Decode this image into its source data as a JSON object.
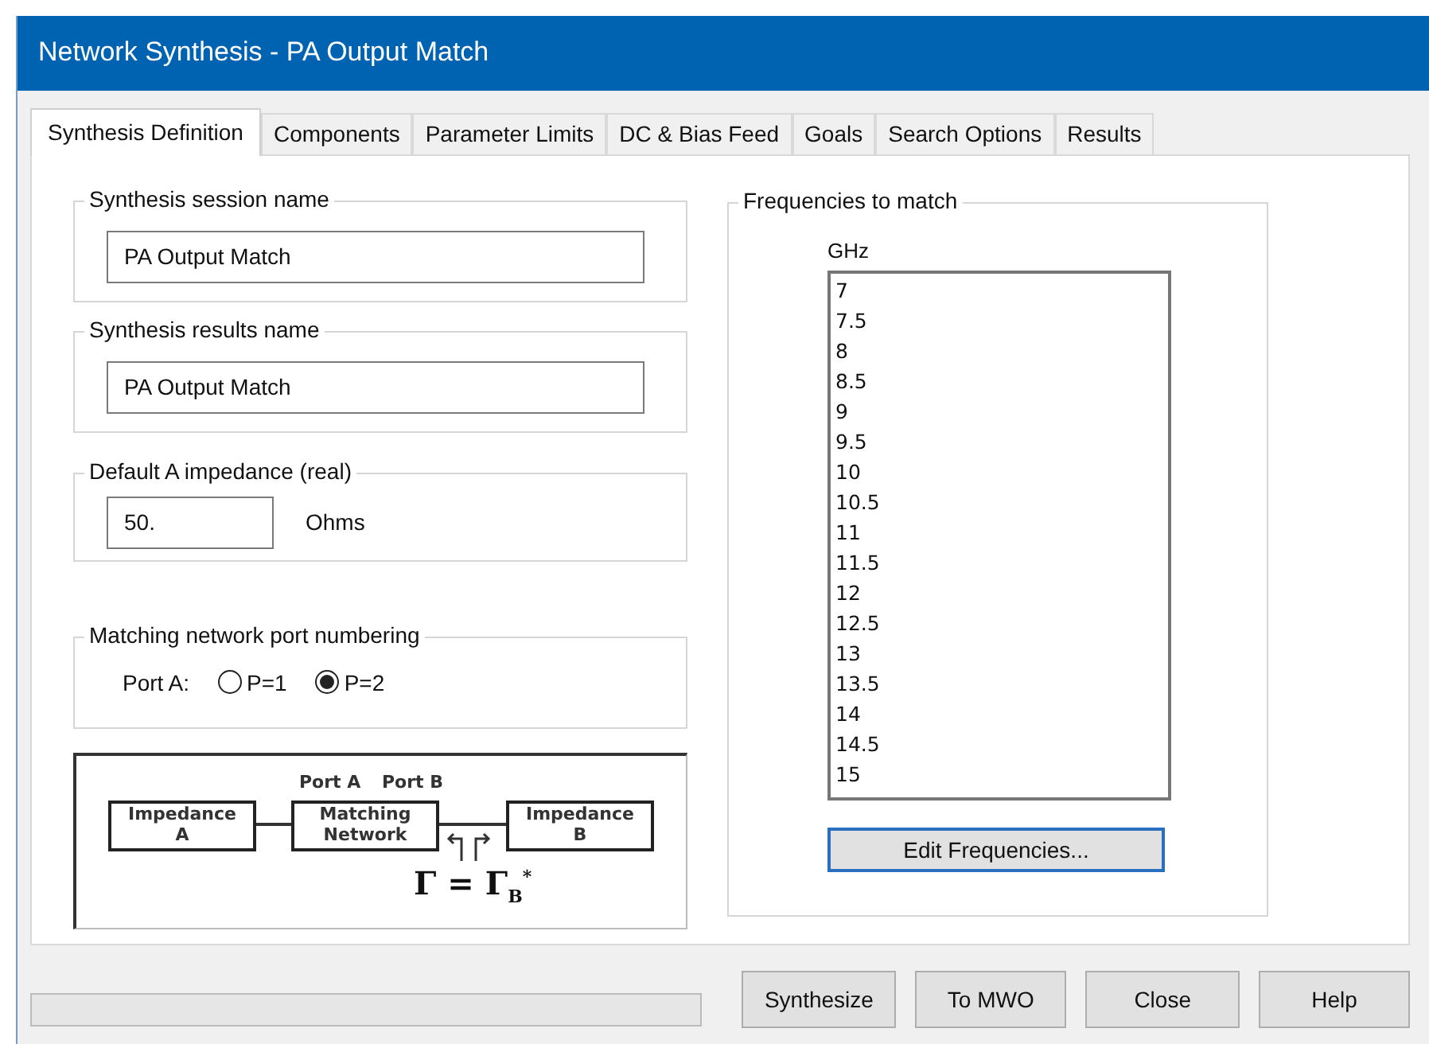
{
  "window": {
    "title": "Network Synthesis - PA Output Match"
  },
  "tabs": [
    {
      "label": "Synthesis Definition",
      "selected": true
    },
    {
      "label": "Components",
      "selected": false
    },
    {
      "label": "Parameter Limits",
      "selected": false
    },
    {
      "label": "DC & Bias Feed",
      "selected": false
    },
    {
      "label": "Goals",
      "selected": false
    },
    {
      "label": "Search Options",
      "selected": false
    },
    {
      "label": "Results",
      "selected": false
    }
  ],
  "session_name": {
    "label": "Synthesis session name",
    "value": "PA Output Match"
  },
  "results_name": {
    "label": "Synthesis results name",
    "value": "PA Output Match"
  },
  "default_impedance": {
    "label": "Default A impedance (real)",
    "value": "50.",
    "unit": "Ohms"
  },
  "port_numbering": {
    "label": "Matching network port numbering",
    "field_label": "Port A:",
    "options": [
      {
        "label": "P=1",
        "selected": false
      },
      {
        "label": "P=2",
        "selected": true
      }
    ]
  },
  "diagram": {
    "port_labels": [
      "Port A",
      "Port B"
    ],
    "blocks": [
      {
        "lines": [
          "Impedance",
          "A"
        ]
      },
      {
        "lines": [
          "Matching",
          "Network"
        ]
      },
      {
        "lines": [
          "Impedance",
          "B"
        ]
      }
    ],
    "formula": "Γ = Γ$_{B}$$^{*}$"
  },
  "frequencies": {
    "label": "Frequencies to match",
    "unit": "GHz",
    "values": [
      "7",
      "7.5",
      "8",
      "8.5",
      "9",
      "9.5",
      "10",
      "10.5",
      "11",
      "11.5",
      "12",
      "12.5",
      "13",
      "13.5",
      "14",
      "14.5",
      "15"
    ],
    "button": "Edit Frequencies..."
  },
  "progress": {
    "level": 0
  },
  "buttons": [
    "Synthesize",
    "To MWO",
    "Close",
    "Help"
  ]
}
